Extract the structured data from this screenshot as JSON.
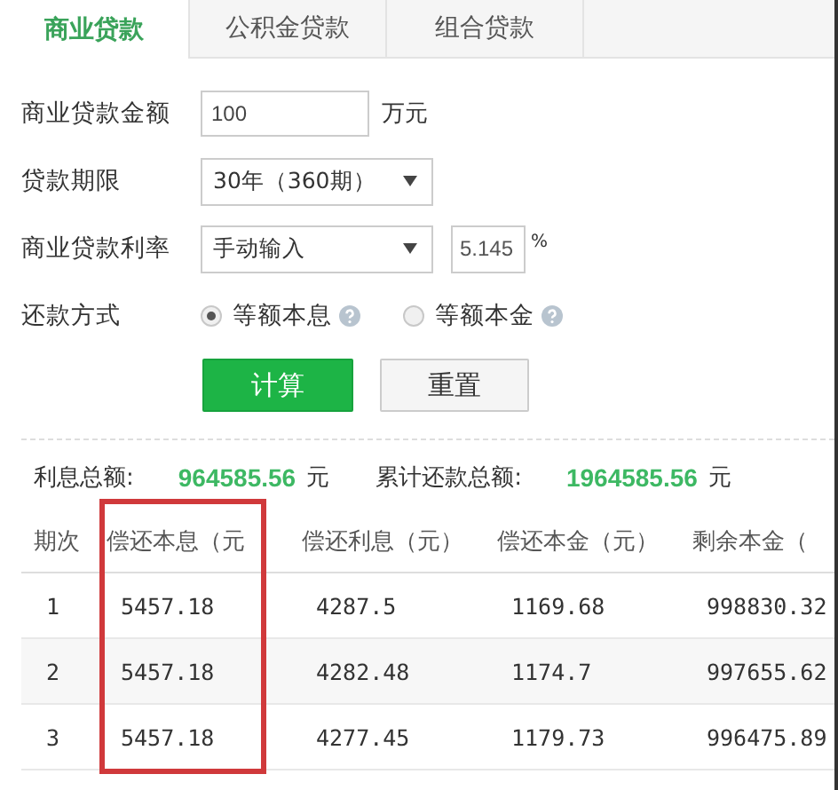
{
  "tabs": [
    {
      "label": "商业贷款",
      "selected": true
    },
    {
      "label": "公积金贷款",
      "selected": false
    },
    {
      "label": "组合贷款",
      "selected": false
    }
  ],
  "form": [
    {
      "kind": "input",
      "label": "商业贷款金额",
      "value": "100",
      "unit": "万元"
    },
    {
      "kind": "select",
      "label": "贷款期限",
      "value": "30年（360期）"
    },
    {
      "kind": "select-rate",
      "label": "商业贷款利率",
      "value": "手动输入",
      "rate": "5.145",
      "unit": "%"
    },
    {
      "kind": "radio",
      "label": "还款方式",
      "options": [
        {
          "label": "等额本息",
          "selected": true
        },
        {
          "label": "等额本金",
          "selected": false
        }
      ]
    }
  ],
  "buttons": [
    {
      "label": "计算",
      "kind": "primary"
    },
    {
      "label": "重置",
      "kind": "secondary"
    }
  ],
  "summary": [
    {
      "label": "利息总额:",
      "value": "964585.56",
      "unit": "元"
    },
    {
      "label": "累计还款总额:",
      "value": "1964585.56",
      "unit": "元"
    }
  ],
  "table": {
    "columns": [
      {
        "label": "期次",
        "highlighted": false
      },
      {
        "label": "偿还本息（元",
        "highlighted": true
      },
      {
        "label": "偿还利息（元）",
        "highlighted": false
      },
      {
        "label": "偿还本金（元）",
        "highlighted": false
      },
      {
        "label": "剩余本金（",
        "highlighted": false
      }
    ],
    "rows": [
      [
        "1",
        "5457.18",
        "4287.5",
        "1169.68",
        "998830.32"
      ],
      [
        "2",
        "5457.18",
        "4282.48",
        "1174.7",
        "997655.62"
      ],
      [
        "3",
        "5457.18",
        "4277.45",
        "1179.73",
        "996475.89"
      ]
    ]
  }
}
